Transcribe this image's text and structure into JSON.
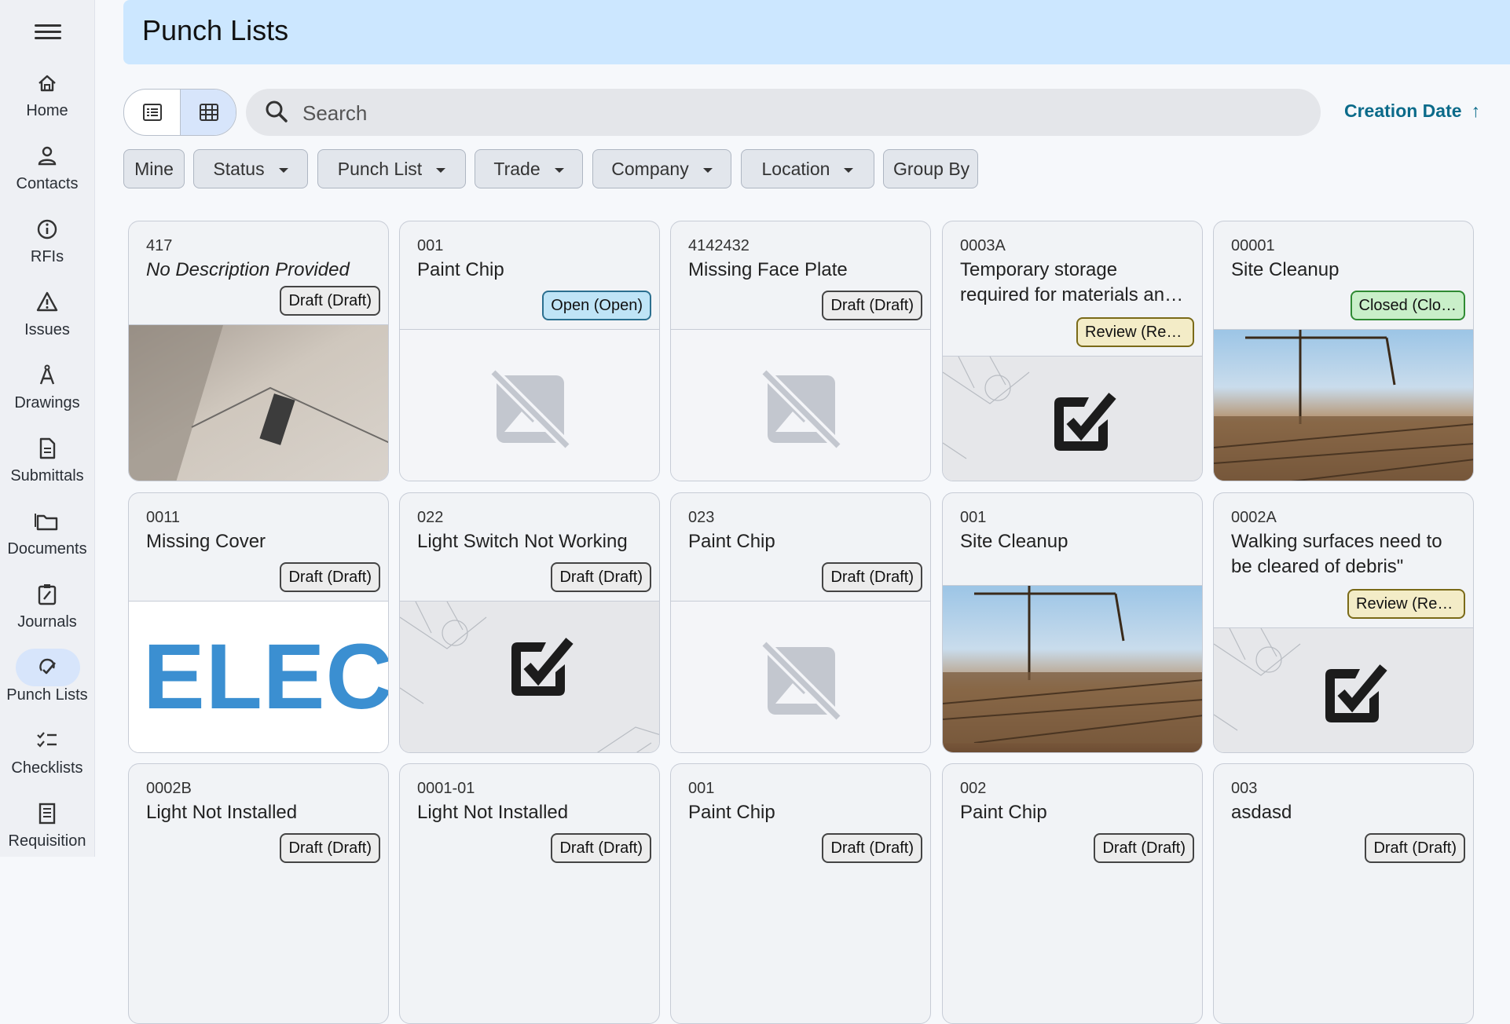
{
  "app": {
    "page_title": "Punch Lists"
  },
  "nav": {
    "items": [
      {
        "label": "Home",
        "icon": "home-icon"
      },
      {
        "label": "Contacts",
        "icon": "person-icon"
      },
      {
        "label": "RFIs",
        "icon": "info-icon"
      },
      {
        "label": "Issues",
        "icon": "warning-icon"
      },
      {
        "label": "Drawings",
        "icon": "compass-icon"
      },
      {
        "label": "Submittals",
        "icon": "document-icon"
      },
      {
        "label": "Documents",
        "icon": "folder-icon"
      },
      {
        "label": "Journals",
        "icon": "clipboard-edit-icon"
      },
      {
        "label": "Punch Lists",
        "icon": "punch-list-icon",
        "active": true
      },
      {
        "label": "Checklists",
        "icon": "checklist-icon"
      },
      {
        "label": "Requisition",
        "icon": "receipt-icon"
      }
    ]
  },
  "toolbar": {
    "search_placeholder": "Search",
    "sort_label": "Creation Date",
    "sort_direction": "ascending",
    "view_modes": [
      "list",
      "grid"
    ],
    "active_view": "grid"
  },
  "filters": [
    "Mine",
    "Status",
    "Punch List",
    "Trade",
    "Company",
    "Location",
    "Group By"
  ],
  "cards": [
    {
      "number": "417",
      "title": "No Description Provided",
      "italic": true,
      "status": "Draft (Draft)",
      "status_kind": "draft",
      "media": "ceiling-photo"
    },
    {
      "number": "001",
      "title": "Paint Chip",
      "status": "Open (Open)",
      "status_kind": "open",
      "media": "no-image"
    },
    {
      "number": "4142432",
      "title": "Missing Face Plate",
      "status": "Draft (Draft)",
      "status_kind": "draft",
      "media": "no-image"
    },
    {
      "number": "0003A",
      "title": "Temporary storage required for materials an…",
      "status": "Review (Rev…",
      "status_kind": "review",
      "media": "checkbox-plan"
    },
    {
      "number": "00001",
      "title": "Site Cleanup",
      "status": "Closed (Clo…",
      "status_kind": "closed",
      "media": "construction-photo"
    },
    {
      "number": "0011",
      "title": "Missing Cover",
      "status": "Draft (Draft)",
      "status_kind": "draft",
      "media": "elec-logo",
      "media_text": "ELEC"
    },
    {
      "number": "022",
      "title": "Light Switch Not Working",
      "status": "Draft (Draft)",
      "status_kind": "draft",
      "media": "checkbox-plan"
    },
    {
      "number": "023",
      "title": "Paint Chip",
      "status": "Draft (Draft)",
      "status_kind": "draft",
      "media": "no-image"
    },
    {
      "number": "001",
      "title": "Site Cleanup",
      "status": "",
      "status_kind": "none",
      "media": "construction-photo"
    },
    {
      "number": "0002A",
      "title": "Walking surfaces need to be cleared of debris\"",
      "status": "Review (Rev…",
      "status_kind": "review",
      "media": "checkbox-plan"
    },
    {
      "number": "0002B",
      "title": "Light Not Installed",
      "status": "Draft (Draft)",
      "status_kind": "draft",
      "media": "none"
    },
    {
      "number": "0001-01",
      "title": "Light Not Installed",
      "status": "Draft (Draft)",
      "status_kind": "draft",
      "media": "none"
    },
    {
      "number": "001",
      "title": "Paint Chip",
      "status": "Draft (Draft)",
      "status_kind": "draft",
      "media": "none"
    },
    {
      "number": "002",
      "title": "Paint Chip",
      "status": "Draft (Draft)",
      "status_kind": "draft",
      "media": "none"
    },
    {
      "number": "003",
      "title": "asdasd",
      "status": "Draft (Draft)",
      "status_kind": "draft",
      "media": "none"
    }
  ],
  "colors": {
    "header_bg": "#cce7ff",
    "accent": "#0b6b8a",
    "active_nav": "#d7e5fb",
    "elec_blue": "#3b8fd1"
  }
}
